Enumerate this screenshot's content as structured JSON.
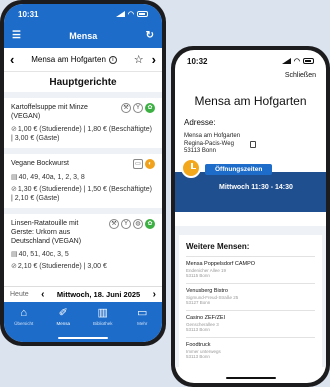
{
  "phone1": {
    "status_time": "10:31",
    "app_title": "Mensa",
    "canteen_name": "Mensa am Hofgarten",
    "section_title": "Hauptgerichte",
    "meals": [
      {
        "name": "Kartoffelsuppe mit Minze (VEGAN)",
        "price": "1,00 € (Studierende) | 1,80 € (Beschäftigte) | 3,00 € (Gäste)",
        "allergens": ""
      },
      {
        "name": "Vegane Bockwurst",
        "allergens": "40, 49, 40a, 1, 2, 3, 8",
        "price": "1,30 € (Studierende) | 1,50 € (Beschäftigte) | 2,10 € (Gäste)"
      },
      {
        "name": "Linsen-Ratatouille mit Gerste: Urkorn aus Deutschland (VEGAN)",
        "allergens": "40, 51, 40c, 3, 5",
        "price": "2,10 € (Studierende) | 3,00 €"
      }
    ],
    "datebar": {
      "today": "Heute",
      "date": "Mittwoch, 18. Juni 2025"
    },
    "tabs": [
      "Übersicht",
      "Mensa",
      "Bibliothek",
      "Mehr"
    ]
  },
  "phone2": {
    "status_time": "10:32",
    "close_label": "Schließen",
    "title": "Mensa am Hofgarten",
    "address_label": "Adresse:",
    "address_lines": [
      "Mensa am Hofgarten",
      "Regina-Pacis-Weg",
      "53113 Bonn"
    ],
    "hours_tab": "Öffnungszeiten",
    "hours_line": "Mittwoch  11:30 - 14:30",
    "more_title": "Weitere Mensen:",
    "others": [
      {
        "name": "Mensa Poppelsdorf CAMPO",
        "street": "Endenicher Allee 19",
        "city": "53115 Bonn"
      },
      {
        "name": "Venusberg Bistro",
        "street": "Sigmund-Freud-Straße 25",
        "city": "53127 Bonn"
      },
      {
        "name": "Casino ZEF/ZEI",
        "street": "Genscherallee 3",
        "city": "53113 Bonn"
      },
      {
        "name": "Foodtruck",
        "street": "Immer unterwegs",
        "city": "53113 Bonn"
      }
    ]
  },
  "colors": {
    "primary": "#1d6cc9",
    "hours_bg": "#1f4f8f",
    "accent_orange": "#f3a81b",
    "vegan_green": "#3cb043",
    "background": "#dbe3ee"
  }
}
